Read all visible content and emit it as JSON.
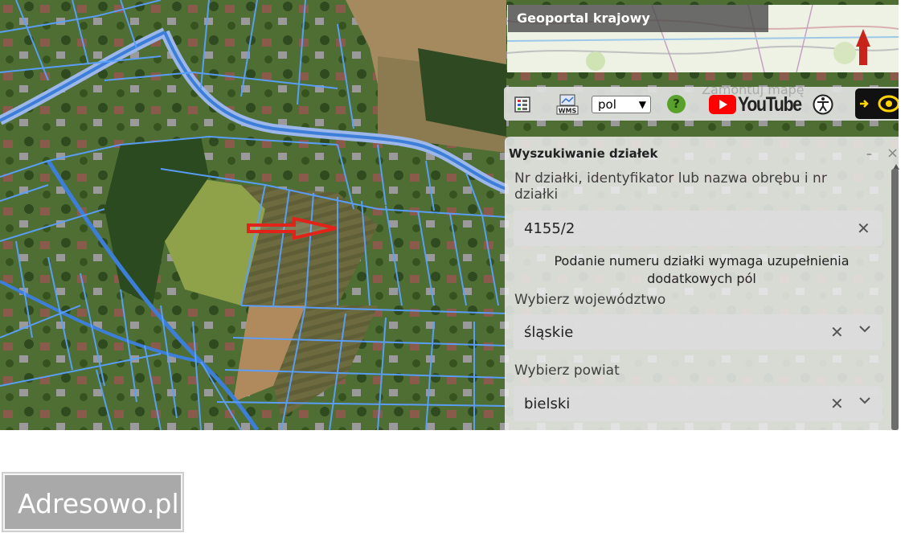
{
  "minimap": {
    "title": "Geoportal krajowy"
  },
  "toolbar": {
    "language": "pol",
    "help_label": "?",
    "youtube_label": "YouTube",
    "ghost_text": "Zamontuj mapę"
  },
  "search_panel": {
    "title": "Wyszukiwanie działek",
    "minimize": "–",
    "close": "×",
    "parcel_label": "Nr działki, identyfikator lub nazwa obrębu i nr działki",
    "parcel_value": "4155/2",
    "note": "Podanie numeru działki wymaga uzupełnienia dodatkowych pól",
    "voivodeship_label": "Wybierz województwo",
    "voivodeship_value": "śląskie",
    "county_label": "Wybierz powiat",
    "county_value": "bielski",
    "clear": "✕"
  },
  "watermark": {
    "text": "Adresowo.pl"
  },
  "colors": {
    "parcel_lines": "#4f9bff",
    "arrow": "#e2231a",
    "panel": "#eeeeee"
  }
}
